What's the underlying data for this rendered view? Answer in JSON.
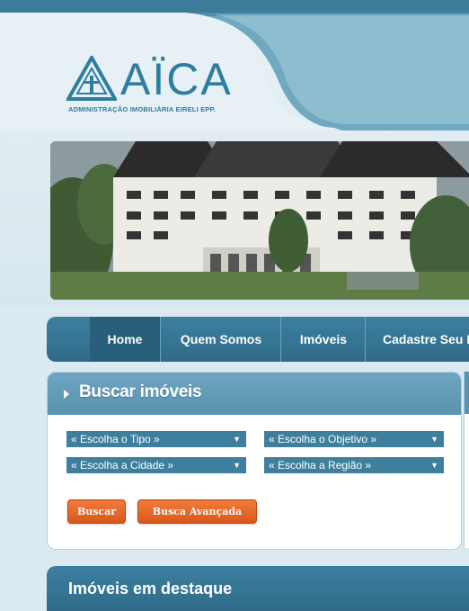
{
  "header": {
    "logo_word": "AÏCA",
    "logo_subtitle": "ADMINISTRAÇÃO IMOBILIÁRIA EIRELI EPP."
  },
  "colors": {
    "brand_blue": "#3f7f9e",
    "accent_orange": "#e0621f",
    "panel_blue": "#5892ae"
  },
  "banner": {
    "icon": "hotel-building-photo"
  },
  "nav": {
    "items": [
      {
        "label": "Home",
        "active": true
      },
      {
        "label": "Quem Somos",
        "active": false
      },
      {
        "label": "Imóveis",
        "active": false
      },
      {
        "label": "Cadastre Seu I",
        "active": false
      }
    ]
  },
  "search": {
    "title": "Buscar imóveis",
    "selects": {
      "tipo": "« Escolha o Tipo »",
      "objetivo": "« Escolha o Objetivo »",
      "cidade": "« Escolha a Cidade »",
      "regiao": "« Escolha a Região »"
    },
    "buttons": {
      "buscar": "Buscar",
      "avancada": "Busca Avançada"
    }
  },
  "featured": {
    "title": "Imóveis em destaque"
  }
}
